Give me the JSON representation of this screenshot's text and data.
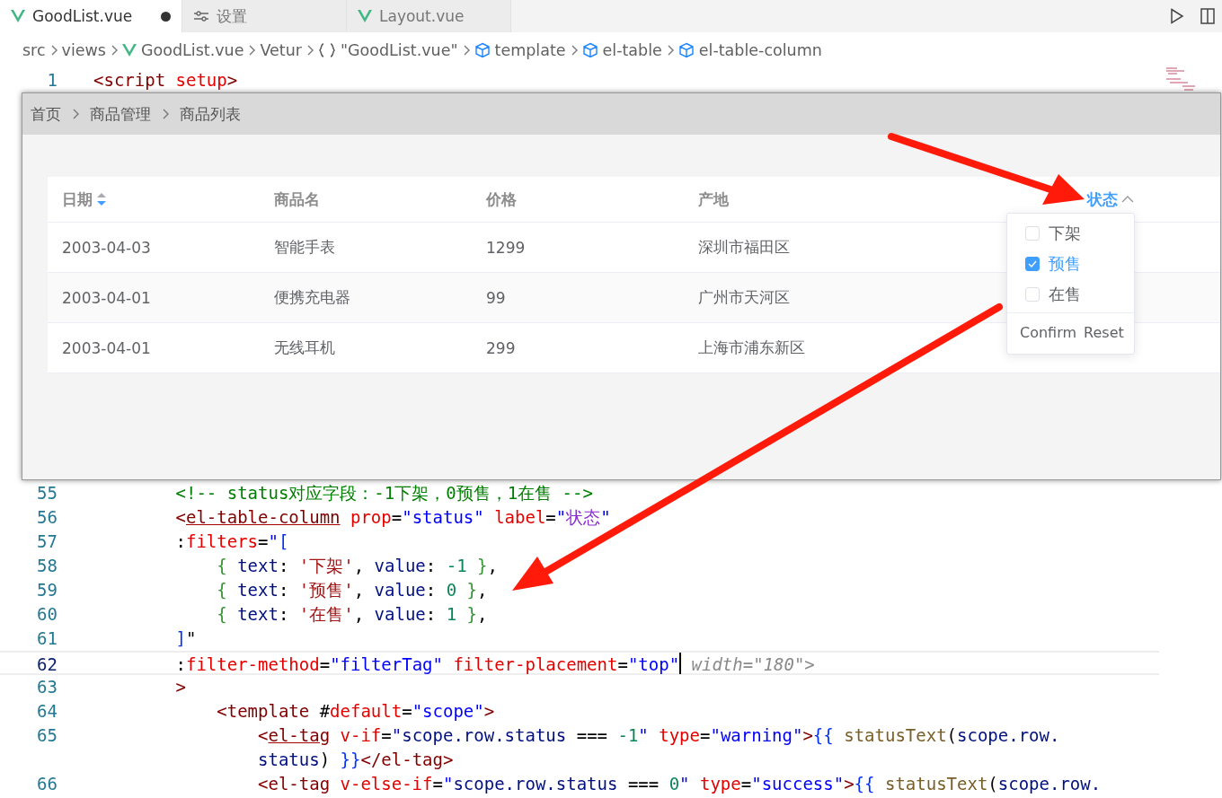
{
  "tabs": [
    {
      "label": "GoodList.vue",
      "kind": "vue",
      "selected": true,
      "modified": true
    },
    {
      "label": "设置",
      "kind": "settings",
      "selected": false,
      "modified": false
    },
    {
      "label": "Layout.vue",
      "kind": "vue",
      "selected": false,
      "modified": false
    }
  ],
  "breadcrumbs": [
    {
      "label": "src",
      "kind": "plain"
    },
    {
      "label": "views",
      "kind": "plain"
    },
    {
      "label": "GoodList.vue",
      "kind": "vue"
    },
    {
      "label": "Vetur",
      "kind": "plain"
    },
    {
      "label": "\"GoodList.vue\"",
      "kind": "braces"
    },
    {
      "label": "template",
      "kind": "cube"
    },
    {
      "label": "el-table",
      "kind": "cube"
    },
    {
      "label": "el-table-column",
      "kind": "cube"
    }
  ],
  "code_top": [
    {
      "number": "1",
      "current": false,
      "tokens": [
        {
          "kind": "tag",
          "text": "<script"
        },
        {
          "kind": "attr",
          "text": " setup"
        },
        {
          "kind": "tag",
          "text": ">"
        }
      ]
    }
  ],
  "code_lines": [
    {
      "number": "55",
      "current": false,
      "tokens": [
        {
          "kind": "comment",
          "text": "        <!-- status对应字段：-1下架，0预售，1在售 -->"
        }
      ]
    },
    {
      "number": "56",
      "current": false,
      "tokens": [
        {
          "kind": "tag",
          "text": "        <"
        },
        {
          "kind": "tag_error",
          "text": "el-table-column"
        },
        {
          "kind": "attr",
          "text": " prop"
        },
        {
          "kind": "plain",
          "text": "="
        },
        {
          "kind": "str",
          "text": "\"status\""
        },
        {
          "kind": "attr",
          "text": " label"
        },
        {
          "kind": "plain",
          "text": "="
        },
        {
          "kind": "str",
          "text": "\""
        },
        {
          "kind": "cjk",
          "text": "状态"
        },
        {
          "kind": "str",
          "text": "\""
        }
      ]
    },
    {
      "number": "57",
      "current": false,
      "tokens": [
        {
          "kind": "plain",
          "text": "        :"
        },
        {
          "kind": "attr",
          "text": "filters"
        },
        {
          "kind": "plain",
          "text": "="
        },
        {
          "kind": "str",
          "text": "\""
        },
        {
          "kind": "bracket",
          "text": "["
        }
      ]
    },
    {
      "number": "58",
      "current": false,
      "tokens": [
        {
          "kind": "brace",
          "text": "            {"
        },
        {
          "kind": "key",
          "text": " text"
        },
        {
          "kind": "plain",
          "text": ": "
        },
        {
          "kind": "jsstr",
          "text": "'下架'"
        },
        {
          "kind": "plain",
          "text": ", "
        },
        {
          "kind": "key",
          "text": "value"
        },
        {
          "kind": "plain",
          "text": ": "
        },
        {
          "kind": "num",
          "text": "-1"
        },
        {
          "kind": "brace",
          "text": " }"
        },
        {
          "kind": "plain",
          "text": ","
        }
      ]
    },
    {
      "number": "59",
      "current": false,
      "tokens": [
        {
          "kind": "brace",
          "text": "            {"
        },
        {
          "kind": "key",
          "text": " text"
        },
        {
          "kind": "plain",
          "text": ": "
        },
        {
          "kind": "jsstr",
          "text": "'预售'"
        },
        {
          "kind": "plain",
          "text": ", "
        },
        {
          "kind": "key",
          "text": "value"
        },
        {
          "kind": "plain",
          "text": ": "
        },
        {
          "kind": "num",
          "text": "0"
        },
        {
          "kind": "brace",
          "text": " }"
        },
        {
          "kind": "plain",
          "text": ","
        }
      ]
    },
    {
      "number": "60",
      "current": false,
      "tokens": [
        {
          "kind": "brace",
          "text": "            {"
        },
        {
          "kind": "key",
          "text": " text"
        },
        {
          "kind": "plain",
          "text": ": "
        },
        {
          "kind": "jsstr",
          "text": "'在售'"
        },
        {
          "kind": "plain",
          "text": ", "
        },
        {
          "kind": "key",
          "text": "value"
        },
        {
          "kind": "plain",
          "text": ": "
        },
        {
          "kind": "num",
          "text": "1"
        },
        {
          "kind": "brace",
          "text": " }"
        },
        {
          "kind": "plain",
          "text": ","
        }
      ]
    },
    {
      "number": "61",
      "current": false,
      "tokens": [
        {
          "kind": "bracket",
          "text": "        ]"
        },
        {
          "kind": "plain",
          "text": "\""
        }
      ]
    },
    {
      "number": "62",
      "current": true,
      "tokens": [
        {
          "kind": "plain",
          "text": "        :"
        },
        {
          "kind": "attr",
          "text": "filter-method"
        },
        {
          "kind": "plain",
          "text": "="
        },
        {
          "kind": "str",
          "text": "\"filterTag\""
        },
        {
          "kind": "attr",
          "text": " filter-placement"
        },
        {
          "kind": "plain",
          "text": "="
        },
        {
          "kind": "str",
          "text": "\"top\""
        },
        {
          "kind": "hint",
          "text": " width=\"180\">"
        }
      ]
    },
    {
      "number": "63",
      "current": false,
      "tokens": [
        {
          "kind": "tag",
          "text": "        >"
        }
      ]
    },
    {
      "number": "64",
      "current": false,
      "tokens": [
        {
          "kind": "tag",
          "text": "            <template"
        },
        {
          "kind": "plain",
          "text": " #"
        },
        {
          "kind": "attr",
          "text": "default"
        },
        {
          "kind": "plain",
          "text": "="
        },
        {
          "kind": "str",
          "text": "\"scope\""
        },
        {
          "kind": "tag",
          "text": ">"
        }
      ]
    },
    {
      "number": "65",
      "current": false,
      "tokens": [
        {
          "kind": "tag",
          "text": "                <"
        },
        {
          "kind": "tag_error",
          "text": "el-tag"
        },
        {
          "kind": "attr",
          "text": " v-if"
        },
        {
          "kind": "plain",
          "text": "="
        },
        {
          "kind": "str",
          "text": "\""
        },
        {
          "kind": "var",
          "text": "scope.row.status"
        },
        {
          "kind": "plain",
          "text": " === "
        },
        {
          "kind": "num",
          "text": "-1"
        },
        {
          "kind": "str",
          "text": "\""
        },
        {
          "kind": "attr",
          "text": " type"
        },
        {
          "kind": "plain",
          "text": "="
        },
        {
          "kind": "str",
          "text": "\"warning\""
        },
        {
          "kind": "tag",
          "text": ">"
        },
        {
          "kind": "bracket",
          "text": "{{"
        },
        {
          "kind": "func",
          "text": " statusText"
        },
        {
          "kind": "plain",
          "text": "("
        },
        {
          "kind": "var",
          "text": "scope.row."
        }
      ]
    },
    {
      "current": false,
      "tokens": [
        {
          "kind": "var",
          "text": "                status"
        },
        {
          "kind": "plain",
          "text": ") "
        },
        {
          "kind": "bracket",
          "text": "}}"
        },
        {
          "kind": "tag",
          "text": "</el-tag>"
        }
      ]
    },
    {
      "number": "66",
      "current": false,
      "tokens": [
        {
          "kind": "tag",
          "text": "                <el-tag"
        },
        {
          "kind": "attr",
          "text": " v-else-if"
        },
        {
          "kind": "plain",
          "text": "="
        },
        {
          "kind": "str",
          "text": "\""
        },
        {
          "kind": "var",
          "text": "scope.row.status"
        },
        {
          "kind": "plain",
          "text": " === "
        },
        {
          "kind": "num",
          "text": "0"
        },
        {
          "kind": "str",
          "text": "\""
        },
        {
          "kind": "attr",
          "text": " type"
        },
        {
          "kind": "plain",
          "text": "="
        },
        {
          "kind": "str",
          "text": "\"success\""
        },
        {
          "kind": "tag",
          "text": ">"
        },
        {
          "kind": "bracket",
          "text": "{{"
        },
        {
          "kind": "func",
          "text": " statusText"
        },
        {
          "kind": "plain",
          "text": "("
        },
        {
          "kind": "var",
          "text": "scope.row."
        }
      ]
    }
  ],
  "preview": {
    "breadcrumb": [
      "首页",
      "商品管理",
      "商品列表"
    ],
    "columns": [
      {
        "label": "日期",
        "kind": "sortable",
        "active": false
      },
      {
        "label": "商品名",
        "kind": "plain",
        "active": false
      },
      {
        "label": "价格",
        "kind": "plain",
        "active": false
      },
      {
        "label": "产地",
        "kind": "plain",
        "active": false
      },
      {
        "label": "状态",
        "kind": "filter",
        "active": true
      }
    ],
    "rows": [
      [
        "2003-04-03",
        "智能手表",
        "1299",
        "深圳市福田区"
      ],
      [
        "2003-04-01",
        "便携充电器",
        "99",
        "广州市天河区"
      ],
      [
        "2003-04-01",
        "无线耳机",
        "299",
        "上海市浦东新区"
      ]
    ],
    "filter": {
      "options": [
        {
          "label": "下架",
          "checked": false
        },
        {
          "label": "预售",
          "checked": true
        },
        {
          "label": "在售",
          "checked": false
        }
      ],
      "buttons": [
        "Confirm",
        "Reset"
      ]
    }
  }
}
